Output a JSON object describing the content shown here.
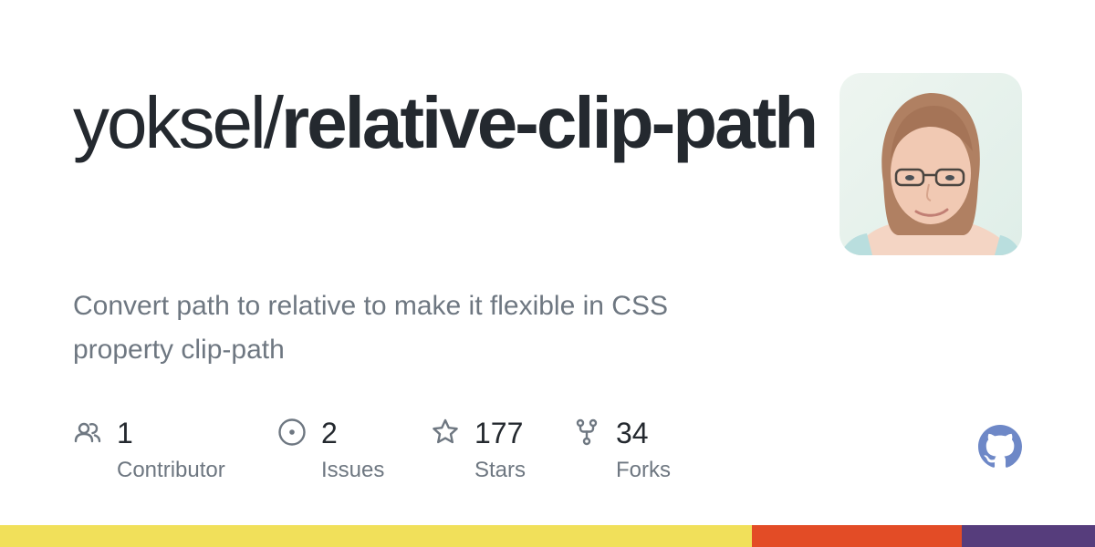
{
  "repo": {
    "owner": "yoksel/",
    "name": "relative-clip-path",
    "description": "Convert path to relative to make it flexible in CSS property clip-path"
  },
  "avatar": {
    "icon": "user-avatar-photo"
  },
  "stats": [
    {
      "icon": "people-icon",
      "value": "1",
      "label": "Contributor"
    },
    {
      "icon": "issue-icon",
      "value": "2",
      "label": "Issues"
    },
    {
      "icon": "star-icon",
      "value": "177",
      "label": "Stars"
    },
    {
      "icon": "fork-icon",
      "value": "34",
      "label": "Forks"
    }
  ],
  "github_mark": {
    "icon": "github-icon",
    "color": "#6e88c7"
  },
  "language_bar": [
    {
      "color": "#f1e05a",
      "fraction": 0.687
    },
    {
      "color": "#e34c26",
      "fraction": 0.191
    },
    {
      "color": "#563d7c",
      "fraction": 0.122
    }
  ]
}
